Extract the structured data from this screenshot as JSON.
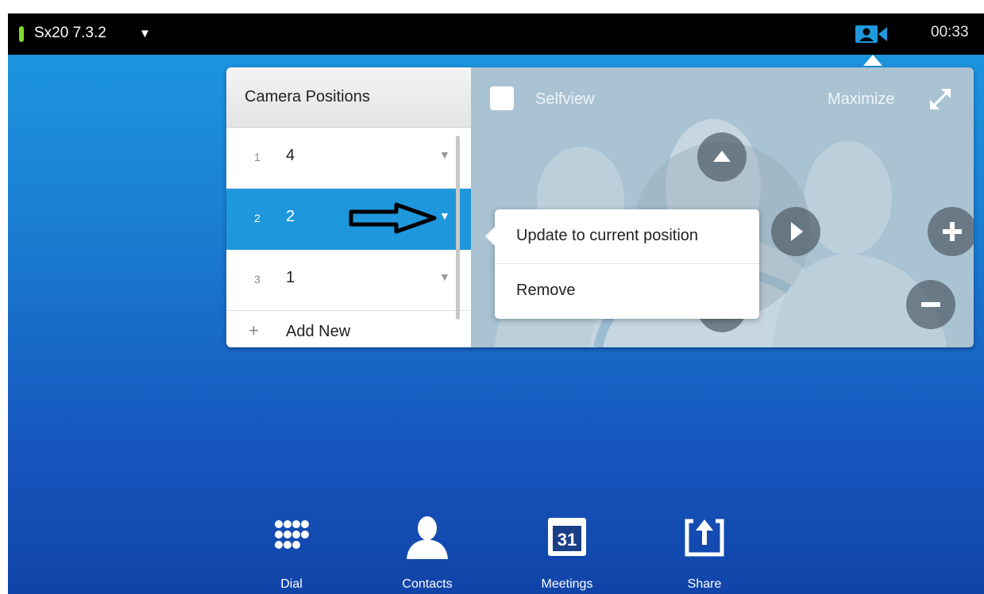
{
  "topbar": {
    "device": "Sx20 7.3.2",
    "time": "00:33"
  },
  "camera_panel": {
    "title": "Camera Positions",
    "positions": [
      {
        "index": "1",
        "name": "4",
        "selected": false
      },
      {
        "index": "2",
        "name": "2",
        "selected": true
      },
      {
        "index": "3",
        "name": "1",
        "selected": false
      }
    ],
    "add_new": "Add New",
    "selfview_label": "Selfview",
    "maximize_label": "Maximize"
  },
  "popup_menu": {
    "items": [
      "Update to current position",
      "Remove"
    ]
  },
  "bottom_nav": {
    "items": [
      {
        "label": "Dial",
        "icon": "dialpad-icon"
      },
      {
        "label": "Contacts",
        "icon": "contacts-icon"
      },
      {
        "label": "Meetings",
        "icon": "calendar-icon"
      },
      {
        "label": "Share",
        "icon": "share-icon"
      }
    ],
    "calendar_day": "31"
  },
  "colors": {
    "accent": "#1e97dc",
    "status_led": "#7ddc2a",
    "camera_tab": "#1e97dc"
  }
}
